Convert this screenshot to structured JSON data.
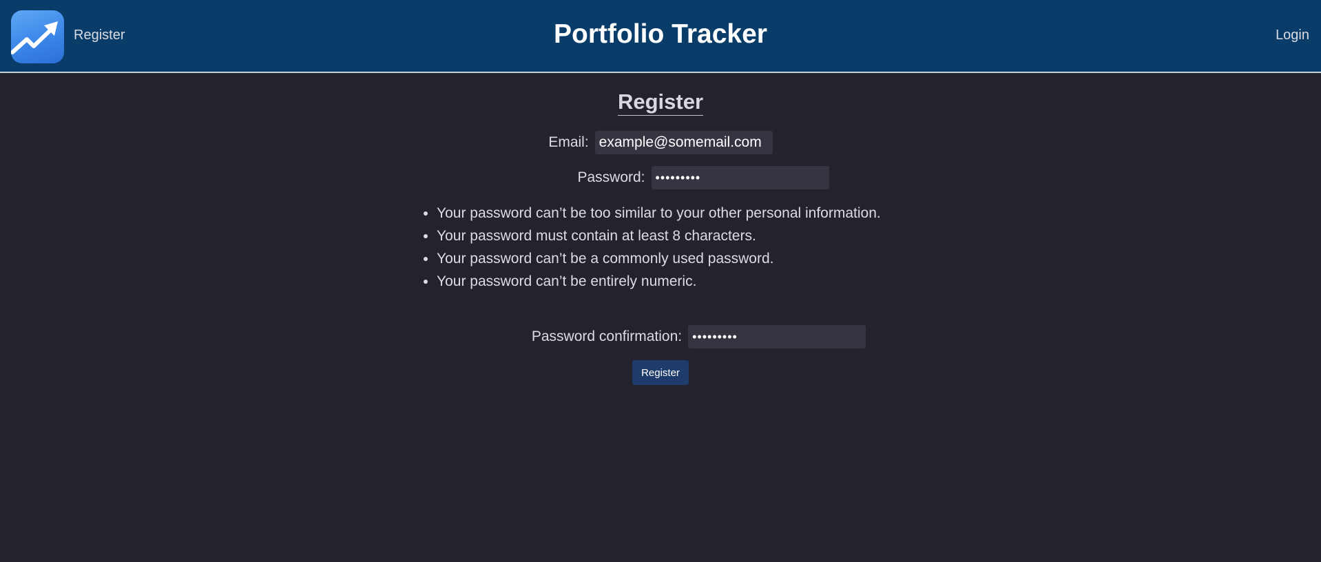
{
  "header": {
    "logo_icon": "trending-up-icon",
    "register_link": "Register",
    "title": "Portfolio Tracker",
    "login_link": "Login"
  },
  "form": {
    "title": "Register",
    "email_label": "Email:",
    "email_value": "example@somemail.com",
    "password_label": "Password:",
    "password_value": "•••••••••",
    "help_text": [
      "Your password can’t be too similar to your other personal information.",
      "Your password must contain at least 8 characters.",
      "Your password can’t be a commonly used password.",
      "Your password can’t be entirely numeric."
    ],
    "confirm_label": "Password confirmation:",
    "confirm_value": "•••••••••",
    "submit_label": "Register"
  },
  "colors": {
    "navbar_bg": "#0a3c6a",
    "page_bg": "#23232d",
    "input_bg": "#353542",
    "button_bg": "#1d3c6b"
  }
}
